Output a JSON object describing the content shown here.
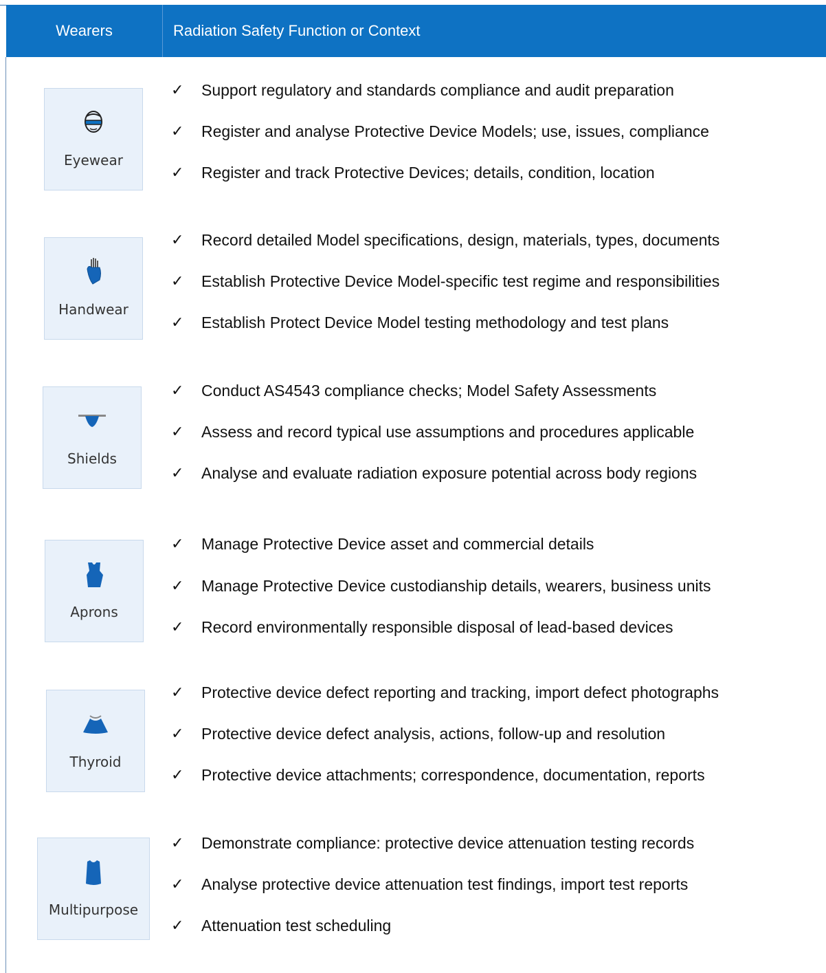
{
  "header": {
    "col1": "Wearers",
    "col2": "Radiation Safety Function or Context"
  },
  "check_glyph": "✓",
  "groups": [
    {
      "label": "Eyewear",
      "icon": "eyewear-icon",
      "items": [
        "Support regulatory and standards compliance and audit preparation",
        "Register and analyse Protective Device Models; use, issues, compliance",
        "Register and track Protective Devices; details, condition, location"
      ]
    },
    {
      "label": "Handwear",
      "icon": "handwear-icon",
      "items": [
        "Record detailed Model specifications, design, materials, types, documents",
        "Establish Protective Device Model-specific test regime and responsibilities",
        "Establish Protect Device Model testing methodology and test plans"
      ]
    },
    {
      "label": "Shields",
      "icon": "shield-icon",
      "items": [
        "Conduct AS4543 compliance checks; Model Safety Assessments",
        "Assess and record typical use assumptions and procedures applicable",
        "Analyse and evaluate radiation exposure potential across body regions"
      ]
    },
    {
      "label": "Aprons",
      "icon": "apron-icon",
      "items": [
        "Manage Protective Device asset and commercial details",
        "Manage Protective Device custodianship details, wearers, business units",
        "Record environmentally responsible disposal of lead-based devices"
      ]
    },
    {
      "label": "Thyroid",
      "icon": "thyroid-collar-icon",
      "items": [
        "Protective device defect reporting and tracking, import defect photographs",
        "Protective device defect analysis, actions, follow-up and resolution",
        "Protective device attachments; correspondence, documentation, reports"
      ]
    },
    {
      "label": "Multipurpose",
      "icon": "multipurpose-garment-icon",
      "items": [
        "Demonstrate compliance: protective device attenuation testing records",
        "Analyse protective device attenuation test findings, import test reports",
        "Attenuation test scheduling"
      ]
    }
  ]
}
